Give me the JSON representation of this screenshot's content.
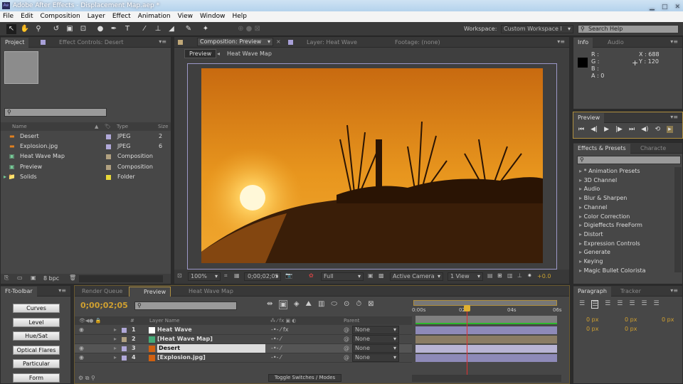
{
  "window": {
    "title": "Adobe After Effects - Displacement Map.aep *",
    "logo": "Ae",
    "controls": [
      "minimize-icon",
      "maximize-icon",
      "close-icon"
    ]
  },
  "menu": [
    "File",
    "Edit",
    "Composition",
    "Layer",
    "Effect",
    "Animation",
    "View",
    "Window",
    "Help"
  ],
  "toolbar": {
    "workspace_label": "Workspace:",
    "workspace_value": "Custom Workspace I",
    "search_placeholder": "Search Help"
  },
  "project": {
    "tab": "Project",
    "effect_controls_tab": "Effect Controls: Desert",
    "columns": {
      "name": "Name",
      "type": "Type",
      "size": "Size"
    },
    "items": [
      {
        "name": "Desert",
        "type": "JPEG",
        "size": "2",
        "color": "#b0a8d8"
      },
      {
        "name": "Explosion.jpg",
        "type": "JPEG",
        "size": "6",
        "color": "#b0a8d8"
      },
      {
        "name": "Heat Wave Map",
        "type": "Composition",
        "size": "",
        "color": "#b0a080"
      },
      {
        "name": "Preview",
        "type": "Composition",
        "size": "",
        "color": "#b0a080"
      },
      {
        "name": "Solids",
        "type": "Folder",
        "size": "",
        "color": "#e8d838"
      }
    ],
    "bpc": "8 bpc"
  },
  "composition": {
    "tab": "Composition: Preview",
    "layer_tab": "Layer: Heat Wave",
    "footage_tab": "Footage: (none)",
    "breadcrumb": [
      "Preview",
      "Heat Wave Map"
    ],
    "zoom": "100%",
    "timecode": "0;00;02;05",
    "resolution": "Full",
    "camera": "Active Camera",
    "views": "1 View",
    "exposure": "+0.0"
  },
  "info": {
    "tab": "Info",
    "audio_tab": "Audio",
    "r": "R :",
    "g": "G :",
    "b": "B :",
    "a": "A : 0",
    "x": "X : 688",
    "y": "Y : 120"
  },
  "preview": {
    "tab": "Preview"
  },
  "effects": {
    "tab": "Effects & Presets",
    "character_tab": "Characte",
    "items": [
      "* Animation Presets",
      "3D Channel",
      "Audio",
      "Blur & Sharpen",
      "Channel",
      "Color Correction",
      "Digieffects FreeForm",
      "Distort",
      "Expression Controls",
      "Generate",
      "Keying",
      "Magic Bullet Colorista"
    ]
  },
  "paragraph": {
    "tab": "Paragraph",
    "tracker_tab": "Tracker",
    "values": [
      "0 px",
      "0 px",
      "0 px",
      "0 px",
      "0 px"
    ]
  },
  "ft_toolbar": {
    "tab": "Ft-Toolbar",
    "buttons": [
      "Curves",
      "Level",
      "Hue/Sat",
      "Optical Flares",
      "Particular",
      "Form"
    ]
  },
  "timeline": {
    "tabs": [
      "Render Queue",
      "Preview",
      "Heat Wave Map"
    ],
    "timecode": "0;00;02;05",
    "columns": {
      "num": "#",
      "layer_name": "Layer Name",
      "parent": "Parent"
    },
    "layers": [
      {
        "num": "1",
        "name": "Heat Wave",
        "parent": "None",
        "color": "#b0a8d8",
        "bar": "#8e8ab8"
      },
      {
        "num": "2",
        "name": "[Heat Wave Map]",
        "parent": "None",
        "color": "#b0a080",
        "bar": "#8a7c64"
      },
      {
        "num": "3",
        "name": "Desert",
        "parent": "None",
        "color": "#b0a8d8",
        "bar": "#b8b4d4"
      },
      {
        "num": "4",
        "name": "[Explosion.jpg]",
        "parent": "None",
        "color": "#b0a8d8",
        "bar": "#8e8ab8"
      }
    ],
    "ruler": [
      "0:00s",
      "02s",
      "04s",
      "06s"
    ],
    "toggle_label": "Toggle Switches / Modes",
    "playhead_seconds": 2.17,
    "duration_seconds": 6
  }
}
